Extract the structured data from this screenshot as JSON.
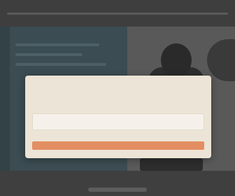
{
  "modal": {
    "title": "",
    "heading": "",
    "input_placeholder": "",
    "button_label": ""
  },
  "colors": {
    "backdrop": "#4a4a4a",
    "left_panel": "#3b4c52",
    "modal_background": "#ece4d6",
    "accent_button": "#e38e62"
  },
  "icons": {
    "avatar": "person-silhouette-icon"
  }
}
